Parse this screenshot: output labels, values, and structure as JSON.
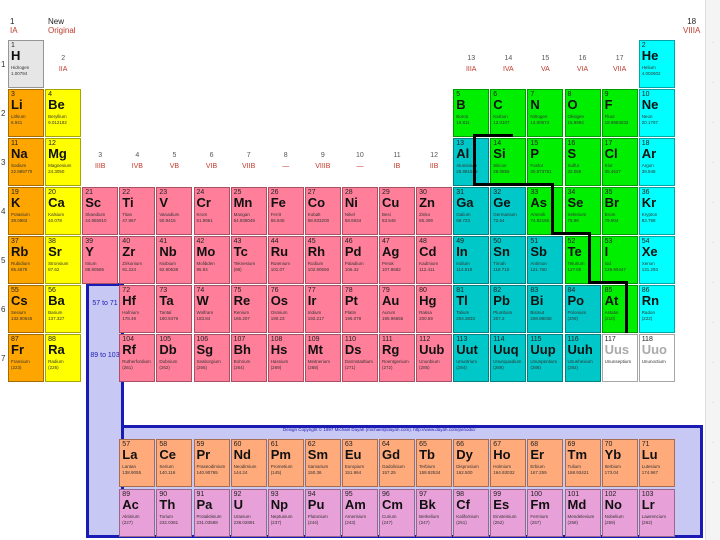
{
  "header": {
    "ia_num": "1",
    "ia_label": "IA",
    "new_label": "New",
    "original_label": "Original",
    "viiia_num": "18",
    "viiia_label": "VIIIA"
  },
  "groups": [
    {
      "n": "2",
      "r": "IIA"
    },
    {
      "n": "3",
      "r": "IIIB"
    },
    {
      "n": "4",
      "r": "IVB"
    },
    {
      "n": "5",
      "r": "VB"
    },
    {
      "n": "6",
      "r": "VIB"
    },
    {
      "n": "7",
      "r": "VIIB"
    },
    {
      "n": "8",
      "r": "—"
    },
    {
      "n": "9",
      "r": "VIIIB"
    },
    {
      "n": "10",
      "r": "—"
    },
    {
      "n": "11",
      "r": "IB"
    },
    {
      "n": "12",
      "r": "IIB"
    },
    {
      "n": "13",
      "r": "IIIA"
    },
    {
      "n": "14",
      "r": "IVA"
    },
    {
      "n": "15",
      "r": "VA"
    },
    {
      "n": "16",
      "r": "VIA"
    },
    {
      "n": "17",
      "r": "VIIA"
    }
  ],
  "periods": [
    "1",
    "2",
    "3",
    "4",
    "5",
    "6",
    "7"
  ],
  "placeholders": {
    "lanthanide_range": "57 to 71",
    "actinide_range": "89 to 103"
  },
  "copyright": "Design Copyright © 1997 Michael Dayah (michael@dayah.com). http://www.dayah.com/periodic/",
  "colors": {
    "alkali": "#ffa500",
    "alkaline": "#ffff00",
    "transition": "#ff7f9a",
    "poor": "#00c8c8",
    "nonmetal": "#00ee00",
    "noble": "#00ffff",
    "hydrogen": "#e6e6e6",
    "lanthanide": "#ffaa7a",
    "actinide": "#e8a0d8",
    "unknown": "#ffffff",
    "border": "#1a1ab4"
  },
  "elements": [
    {
      "z": "1",
      "s": "H",
      "n": "Hidrogen",
      "m": "1.00794",
      "c": 1,
      "r": 1,
      "t": "hydrogen"
    },
    {
      "z": "2",
      "s": "He",
      "n": "Helium",
      "m": "4.002602",
      "c": 18,
      "r": 1,
      "t": "noble"
    },
    {
      "z": "3",
      "s": "Li",
      "n": "Lithium",
      "m": "6.941",
      "c": 1,
      "r": 2,
      "t": "alkali"
    },
    {
      "z": "4",
      "s": "Be",
      "n": "Beryllium",
      "m": "9.012182",
      "c": 2,
      "r": 2,
      "t": "alkaline"
    },
    {
      "z": "5",
      "s": "B",
      "n": "Boron",
      "m": "10.811",
      "c": 13,
      "r": 2,
      "t": "nonmetal"
    },
    {
      "z": "6",
      "s": "C",
      "n": "Karbon",
      "m": "12.0107",
      "c": 14,
      "r": 2,
      "t": "nonmetal"
    },
    {
      "z": "7",
      "s": "N",
      "n": "Nitrogen",
      "m": "14.00674",
      "c": 15,
      "r": 2,
      "t": "nonmetal"
    },
    {
      "z": "8",
      "s": "O",
      "n": "Oksigen",
      "m": "15.9994",
      "c": 16,
      "r": 2,
      "t": "nonmetal"
    },
    {
      "z": "9",
      "s": "F",
      "n": "Fluor",
      "m": "18.9984032",
      "c": 17,
      "r": 2,
      "t": "nonmetal"
    },
    {
      "z": "10",
      "s": "Ne",
      "n": "Neon",
      "m": "20.1797",
      "c": 18,
      "r": 2,
      "t": "noble"
    },
    {
      "z": "11",
      "s": "Na",
      "n": "Sodium",
      "m": "22.989770",
      "c": 1,
      "r": 3,
      "t": "alkali"
    },
    {
      "z": "12",
      "s": "Mg",
      "n": "Magnesium",
      "m": "24.3050",
      "c": 2,
      "r": 3,
      "t": "alkaline"
    },
    {
      "z": "13",
      "s": "Al",
      "n": "Aluminium",
      "m": "26.981538",
      "c": 13,
      "r": 3,
      "t": "poor"
    },
    {
      "z": "14",
      "s": "Si",
      "n": "Silicon",
      "m": "28.0855",
      "c": 14,
      "r": 3,
      "t": "nonmetal"
    },
    {
      "z": "15",
      "s": "P",
      "n": "Fosfor",
      "m": "30.973761",
      "c": 15,
      "r": 3,
      "t": "nonmetal"
    },
    {
      "z": "16",
      "s": "S",
      "n": "Sulfur",
      "m": "32.066",
      "c": 16,
      "r": 3,
      "t": "nonmetal"
    },
    {
      "z": "17",
      "s": "Cl",
      "n": "Klor",
      "m": "35.4527",
      "c": 17,
      "r": 3,
      "t": "nonmetal"
    },
    {
      "z": "18",
      "s": "Ar",
      "n": "Argon",
      "m": "39.948",
      "c": 18,
      "r": 3,
      "t": "noble"
    },
    {
      "z": "19",
      "s": "K",
      "n": "Potasium",
      "m": "39.0983",
      "c": 1,
      "r": 4,
      "t": "alkali"
    },
    {
      "z": "20",
      "s": "Ca",
      "n": "Kalsium",
      "m": "40.078",
      "c": 2,
      "r": 4,
      "t": "alkaline"
    },
    {
      "z": "21",
      "s": "Sc",
      "n": "Skandium",
      "m": "44.955910",
      "c": 3,
      "r": 4,
      "t": "transition"
    },
    {
      "z": "22",
      "s": "Ti",
      "n": "Titan",
      "m": "47.867",
      "c": 4,
      "r": 4,
      "t": "transition"
    },
    {
      "z": "23",
      "s": "V",
      "n": "Vanadium",
      "m": "50.9415",
      "c": 5,
      "r": 4,
      "t": "transition"
    },
    {
      "z": "24",
      "s": "Cr",
      "n": "Krom",
      "m": "51.9961",
      "c": 6,
      "r": 4,
      "t": "transition"
    },
    {
      "z": "25",
      "s": "Mn",
      "n": "Mangan",
      "m": "54.938049",
      "c": 7,
      "r": 4,
      "t": "transition"
    },
    {
      "z": "26",
      "s": "Fe",
      "n": "Ferrit",
      "m": "55.845",
      "c": 8,
      "r": 4,
      "t": "transition"
    },
    {
      "z": "27",
      "s": "Co",
      "n": "Kobalt",
      "m": "58.933200",
      "c": 9,
      "r": 4,
      "t": "transition"
    },
    {
      "z": "28",
      "s": "Ni",
      "n": "Nikel",
      "m": "58.6934",
      "c": 10,
      "r": 4,
      "t": "transition"
    },
    {
      "z": "29",
      "s": "Cu",
      "n": "Besi",
      "m": "63.546",
      "c": 11,
      "r": 4,
      "t": "transition"
    },
    {
      "z": "30",
      "s": "Zn",
      "n": "Zinko",
      "m": "65.409",
      "c": 12,
      "r": 4,
      "t": "transition"
    },
    {
      "z": "31",
      "s": "Ga",
      "n": "Galium",
      "m": "69.723",
      "c": 13,
      "r": 4,
      "t": "poor"
    },
    {
      "z": "32",
      "s": "Ge",
      "n": "Germanium",
      "m": "72.64",
      "c": 14,
      "r": 4,
      "t": "poor"
    },
    {
      "z": "33",
      "s": "As",
      "n": "Arsenik",
      "m": "74.92160",
      "c": 15,
      "r": 4,
      "t": "nonmetal"
    },
    {
      "z": "34",
      "s": "Se",
      "n": "Selenium",
      "m": "78.96",
      "c": 16,
      "r": 4,
      "t": "nonmetal"
    },
    {
      "z": "35",
      "s": "Br",
      "n": "Brom",
      "m": "79.904",
      "c": 17,
      "r": 4,
      "t": "nonmetal"
    },
    {
      "z": "36",
      "s": "Kr",
      "n": "Krypton",
      "m": "83.798",
      "c": 18,
      "r": 4,
      "t": "noble"
    },
    {
      "z": "37",
      "s": "Rb",
      "n": "Rubidium",
      "m": "85.4678",
      "c": 1,
      "r": 5,
      "t": "alkali"
    },
    {
      "z": "38",
      "s": "Sr",
      "n": "Stronsium",
      "m": "87.62",
      "c": 2,
      "r": 5,
      "t": "alkaline"
    },
    {
      "z": "39",
      "s": "Y",
      "n": "Itrium",
      "m": "88.90585",
      "c": 3,
      "r": 5,
      "t": "transition"
    },
    {
      "z": "40",
      "s": "Zr",
      "n": "Zirkonium",
      "m": "91.224",
      "c": 4,
      "r": 5,
      "t": "transition"
    },
    {
      "z": "41",
      "s": "Nb",
      "n": "Niobium",
      "m": "92.90638",
      "c": 5,
      "r": 5,
      "t": "transition"
    },
    {
      "z": "42",
      "s": "Mo",
      "n": "Molibden",
      "m": "95.94",
      "c": 6,
      "r": 5,
      "t": "transition"
    },
    {
      "z": "43",
      "s": "Tc",
      "n": "Teknesium",
      "m": "(98)",
      "c": 7,
      "r": 5,
      "t": "transition"
    },
    {
      "z": "44",
      "s": "Ru",
      "n": "Rutenium",
      "m": "101.07",
      "c": 8,
      "r": 5,
      "t": "transition"
    },
    {
      "z": "45",
      "s": "Rh",
      "n": "Rodium",
      "m": "102.90550",
      "c": 9,
      "r": 5,
      "t": "transition"
    },
    {
      "z": "46",
      "s": "Pd",
      "n": "Paladium",
      "m": "106.42",
      "c": 10,
      "r": 5,
      "t": "transition"
    },
    {
      "z": "47",
      "s": "Ag",
      "n": "Perak",
      "m": "107.8682",
      "c": 11,
      "r": 5,
      "t": "transition"
    },
    {
      "z": "48",
      "s": "Cd",
      "n": "Kadmium",
      "m": "112.411",
      "c": 12,
      "r": 5,
      "t": "transition"
    },
    {
      "z": "49",
      "s": "In",
      "n": "Indium",
      "m": "114.818",
      "c": 13,
      "r": 5,
      "t": "poor"
    },
    {
      "z": "50",
      "s": "Sn",
      "n": "Timah",
      "m": "118.710",
      "c": 14,
      "r": 5,
      "t": "poor"
    },
    {
      "z": "51",
      "s": "Sb",
      "n": "Antimon",
      "m": "121.760",
      "c": 15,
      "r": 5,
      "t": "poor"
    },
    {
      "z": "52",
      "s": "Te",
      "n": "Telurium",
      "m": "127.60",
      "c": 16,
      "r": 5,
      "t": "nonmetal"
    },
    {
      "z": "53",
      "s": "I",
      "n": "Iod",
      "m": "126.90447",
      "c": 17,
      "r": 5,
      "t": "nonmetal"
    },
    {
      "z": "54",
      "s": "Xe",
      "n": "Xenon",
      "m": "131.293",
      "c": 18,
      "r": 5,
      "t": "noble"
    },
    {
      "z": "55",
      "s": "Cs",
      "n": "Sesium",
      "m": "132.90545",
      "c": 1,
      "r": 6,
      "t": "alkali"
    },
    {
      "z": "56",
      "s": "Ba",
      "n": "Barium",
      "m": "137.327",
      "c": 2,
      "r": 6,
      "t": "alkaline"
    },
    {
      "z": "72",
      "s": "Hf",
      "n": "Hafnium",
      "m": "178.49",
      "c": 4,
      "r": 6,
      "t": "transition"
    },
    {
      "z": "73",
      "s": "Ta",
      "n": "Tantal",
      "m": "180.9479",
      "c": 5,
      "r": 6,
      "t": "transition"
    },
    {
      "z": "74",
      "s": "W",
      "n": "Wolfram",
      "m": "183.84",
      "c": 6,
      "r": 6,
      "t": "transition"
    },
    {
      "z": "75",
      "s": "Re",
      "n": "Renium",
      "m": "186.207",
      "c": 7,
      "r": 6,
      "t": "transition"
    },
    {
      "z": "76",
      "s": "Os",
      "n": "Osmium",
      "m": "190.23",
      "c": 8,
      "r": 6,
      "t": "transition"
    },
    {
      "z": "77",
      "s": "Ir",
      "n": "Iridium",
      "m": "192.217",
      "c": 9,
      "r": 6,
      "t": "transition"
    },
    {
      "z": "78",
      "s": "Pt",
      "n": "Platin",
      "m": "195.078",
      "c": 10,
      "r": 6,
      "t": "transition"
    },
    {
      "z": "79",
      "s": "Au",
      "n": "Aurum",
      "m": "196.96655",
      "c": 11,
      "r": 6,
      "t": "transition"
    },
    {
      "z": "80",
      "s": "Hg",
      "n": "Raksa",
      "m": "200.59",
      "c": 12,
      "r": 6,
      "t": "transition"
    },
    {
      "z": "81",
      "s": "Tl",
      "n": "Talium",
      "m": "204.3833",
      "c": 13,
      "r": 6,
      "t": "poor"
    },
    {
      "z": "82",
      "s": "Pb",
      "n": "Plumbum",
      "m": "207.2",
      "c": 14,
      "r": 6,
      "t": "poor"
    },
    {
      "z": "83",
      "s": "Bi",
      "n": "Bismut",
      "m": "208.98038",
      "c": 15,
      "r": 6,
      "t": "poor"
    },
    {
      "z": "84",
      "s": "Po",
      "n": "Polonium",
      "m": "(209)",
      "c": 16,
      "r": 6,
      "t": "poor"
    },
    {
      "z": "85",
      "s": "At",
      "n": "Astatin",
      "m": "(210)",
      "c": 17,
      "r": 6,
      "t": "nonmetal"
    },
    {
      "z": "86",
      "s": "Rn",
      "n": "Radon",
      "m": "(222)",
      "c": 18,
      "r": 6,
      "t": "noble"
    },
    {
      "z": "87",
      "s": "Fr",
      "n": "Fransium",
      "m": "(223)",
      "c": 1,
      "r": 7,
      "t": "alkali"
    },
    {
      "z": "88",
      "s": "Ra",
      "n": "Radium",
      "m": "(226)",
      "c": 2,
      "r": 7,
      "t": "alkaline"
    },
    {
      "z": "104",
      "s": "Rf",
      "n": "Rutherfordium",
      "m": "(261)",
      "c": 4,
      "r": 7,
      "t": "transition"
    },
    {
      "z": "105",
      "s": "Db",
      "n": "Dubnium",
      "m": "(262)",
      "c": 5,
      "r": 7,
      "t": "transition"
    },
    {
      "z": "106",
      "s": "Sg",
      "n": "Seaborgium",
      "m": "(266)",
      "c": 6,
      "r": 7,
      "t": "transition"
    },
    {
      "z": "107",
      "s": "Bh",
      "n": "Bohrium",
      "m": "(264)",
      "c": 7,
      "r": 7,
      "t": "transition"
    },
    {
      "z": "108",
      "s": "Hs",
      "n": "Hassium",
      "m": "(269)",
      "c": 8,
      "r": 7,
      "t": "transition"
    },
    {
      "z": "109",
      "s": "Mt",
      "n": "Meitnerium",
      "m": "(268)",
      "c": 9,
      "r": 7,
      "t": "transition"
    },
    {
      "z": "110",
      "s": "Ds",
      "n": "Darmstadtium",
      "m": "(271)",
      "c": 10,
      "r": 7,
      "t": "transition"
    },
    {
      "z": "111",
      "s": "Rg",
      "n": "Roentgenium",
      "m": "(272)",
      "c": 11,
      "r": 7,
      "t": "transition"
    },
    {
      "z": "112",
      "s": "Uub",
      "n": "Ununbium",
      "m": "(285)",
      "c": 12,
      "r": 7,
      "t": "transition"
    },
    {
      "z": "113",
      "s": "Uut",
      "n": "Ununtrium",
      "m": "(284)",
      "c": 13,
      "r": 7,
      "t": "poor"
    },
    {
      "z": "114",
      "s": "Uuq",
      "n": "Ununquadium",
      "m": "(289)",
      "c": 14,
      "r": 7,
      "t": "poor"
    },
    {
      "z": "115",
      "s": "Uup",
      "n": "Ununpentium",
      "m": "(288)",
      "c": 15,
      "r": 7,
      "t": "poor"
    },
    {
      "z": "116",
      "s": "Uuh",
      "n": "Ununhexium",
      "m": "(292)",
      "c": 16,
      "r": 7,
      "t": "poor"
    },
    {
      "z": "117",
      "s": "Uus",
      "n": "Ununseptium",
      "m": "",
      "c": 17,
      "r": 7,
      "t": "unknown"
    },
    {
      "z": "118",
      "s": "Uuo",
      "n": "Ununoctium",
      "m": "",
      "c": 18,
      "r": 7,
      "t": "unknown"
    },
    {
      "z": "57",
      "s": "La",
      "n": "Lantan",
      "m": "138.9055",
      "c": 4,
      "r": 9,
      "t": "lanthanide"
    },
    {
      "z": "58",
      "s": "Ce",
      "n": "Serium",
      "m": "140.116",
      "c": 5,
      "r": 9,
      "t": "lanthanide"
    },
    {
      "z": "59",
      "s": "Pr",
      "n": "Praseodimium",
      "m": "140.90765",
      "c": 6,
      "r": 9,
      "t": "lanthanide"
    },
    {
      "z": "60",
      "s": "Nd",
      "n": "Neodimium",
      "m": "144.24",
      "c": 7,
      "r": 9,
      "t": "lanthanide"
    },
    {
      "z": "61",
      "s": "Pm",
      "n": "Prometium",
      "m": "(145)",
      "c": 8,
      "r": 9,
      "t": "lanthanide"
    },
    {
      "z": "62",
      "s": "Sm",
      "n": "Samarium",
      "m": "150.36",
      "c": 9,
      "r": 9,
      "t": "lanthanide"
    },
    {
      "z": "63",
      "s": "Eu",
      "n": "Europium",
      "m": "151.964",
      "c": 10,
      "r": 9,
      "t": "lanthanide"
    },
    {
      "z": "64",
      "s": "Gd",
      "n": "Gadolinium",
      "m": "157.25",
      "c": 11,
      "r": 9,
      "t": "lanthanide"
    },
    {
      "z": "65",
      "s": "Tb",
      "n": "Terbium",
      "m": "158.92534",
      "c": 12,
      "r": 9,
      "t": "lanthanide"
    },
    {
      "z": "66",
      "s": "Dy",
      "n": "Disprosium",
      "m": "162.500",
      "c": 13,
      "r": 9,
      "t": "lanthanide"
    },
    {
      "z": "67",
      "s": "Ho",
      "n": "Holmium",
      "m": "164.93032",
      "c": 14,
      "r": 9,
      "t": "lanthanide"
    },
    {
      "z": "68",
      "s": "Er",
      "n": "Erbium",
      "m": "167.259",
      "c": 15,
      "r": 9,
      "t": "lanthanide"
    },
    {
      "z": "69",
      "s": "Tm",
      "n": "Tulium",
      "m": "168.93421",
      "c": 16,
      "r": 9,
      "t": "lanthanide"
    },
    {
      "z": "70",
      "s": "Yb",
      "n": "Iterbium",
      "m": "173.04",
      "c": 17,
      "r": 9,
      "t": "lanthanide"
    },
    {
      "z": "71",
      "s": "Lu",
      "n": "Lutesium",
      "m": "174.967",
      "c": 18,
      "r": 9,
      "t": "lanthanide"
    },
    {
      "z": "89",
      "s": "Ac",
      "n": "Aktinium",
      "m": "(227)",
      "c": 4,
      "r": 10,
      "t": "actinide"
    },
    {
      "z": "90",
      "s": "Th",
      "n": "Torium",
      "m": "232.0381",
      "c": 5,
      "r": 10,
      "t": "actinide"
    },
    {
      "z": "91",
      "s": "Pa",
      "n": "Protaktinium",
      "m": "231.03588",
      "c": 6,
      "r": 10,
      "t": "actinide"
    },
    {
      "z": "92",
      "s": "U",
      "n": "Uranium",
      "m": "238.02891",
      "c": 7,
      "r": 10,
      "t": "actinide"
    },
    {
      "z": "93",
      "s": "Np",
      "n": "Neptunium",
      "m": "(237)",
      "c": 8,
      "r": 10,
      "t": "actinide"
    },
    {
      "z": "94",
      "s": "Pu",
      "n": "Plutonium",
      "m": "(244)",
      "c": 9,
      "r": 10,
      "t": "actinide"
    },
    {
      "z": "95",
      "s": "Am",
      "n": "Amerisium",
      "m": "(243)",
      "c": 10,
      "r": 10,
      "t": "actinide"
    },
    {
      "z": "96",
      "s": "Cm",
      "n": "Curium",
      "m": "(247)",
      "c": 11,
      "r": 10,
      "t": "actinide"
    },
    {
      "z": "97",
      "s": "Bk",
      "n": "Berkelium",
      "m": "(247)",
      "c": 12,
      "r": 10,
      "t": "actinide"
    },
    {
      "z": "98",
      "s": "Cf",
      "n": "Kalifornium",
      "m": "(251)",
      "c": 13,
      "r": 10,
      "t": "actinide"
    },
    {
      "z": "99",
      "s": "Es",
      "n": "Einsteinium",
      "m": "(252)",
      "c": 14,
      "r": 10,
      "t": "actinide"
    },
    {
      "z": "100",
      "s": "Fm",
      "n": "Fermium",
      "m": "(257)",
      "c": 15,
      "r": 10,
      "t": "actinide"
    },
    {
      "z": "101",
      "s": "Md",
      "n": "Mendelevium",
      "m": "(258)",
      "c": 16,
      "r": 10,
      "t": "actinide"
    },
    {
      "z": "102",
      "s": "No",
      "n": "Nobelium",
      "m": "(259)",
      "c": 17,
      "r": 10,
      "t": "actinide"
    },
    {
      "z": "103",
      "s": "Lr",
      "n": "Lawrencium",
      "m": "(262)",
      "c": 18,
      "r": 10,
      "t": "actinide"
    }
  ]
}
